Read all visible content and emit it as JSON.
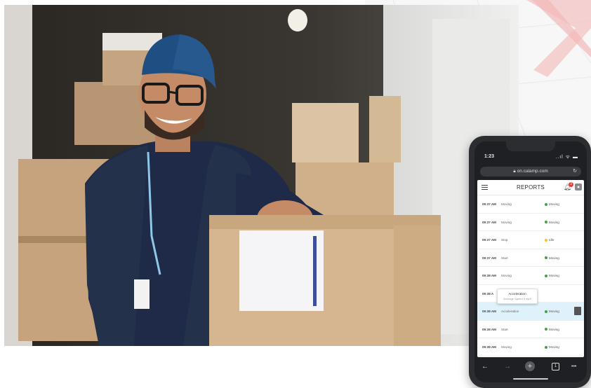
{
  "phone": {
    "status_time": "1:23",
    "status_icons": "..ıl ᯤ ▬",
    "url": "on.calamp.com",
    "app_title": "REPORTS",
    "notification_count": "3",
    "rows": [
      {
        "time": "09:37 AM",
        "event": "Moving",
        "status": "Moving",
        "status_color": "#43a047"
      },
      {
        "time": "09:37 AM",
        "event": "Moving",
        "status": "Moving",
        "status_color": "#43a047"
      },
      {
        "time": "09:37 AM",
        "event": "Stop",
        "status": "Idle",
        "status_color": "#fbc02d"
      },
      {
        "time": "09:37 AM",
        "event": "Start",
        "status": "Moving",
        "status_color": "#43a047"
      },
      {
        "time": "09:38 AM",
        "event": "Moving",
        "status": "Moving",
        "status_color": "#43a047"
      },
      {
        "time": "09:38 A",
        "event": "",
        "status": "",
        "status_color": "#43a047"
      },
      {
        "time": "09:38 AM",
        "event": "Acceleration",
        "status": "Moving",
        "status_color": "#43a047"
      },
      {
        "time": "09:38 AM",
        "event": "Start",
        "status": "Moving",
        "status_color": "#43a047"
      },
      {
        "time": "09:38 AM",
        "event": "Moving",
        "status": "Moving",
        "status_color": "#43a047"
      }
    ],
    "tooltip": {
      "title": "Acceleration",
      "subtitle": "Average Speed 0 mph"
    },
    "nav": {
      "back": "←",
      "forward": "→",
      "new_tab": "+",
      "tabs": "1",
      "more": "•••"
    }
  },
  "colors": {
    "map_accent": "#f2b8b8",
    "highlight_row": "#dff2fb"
  }
}
